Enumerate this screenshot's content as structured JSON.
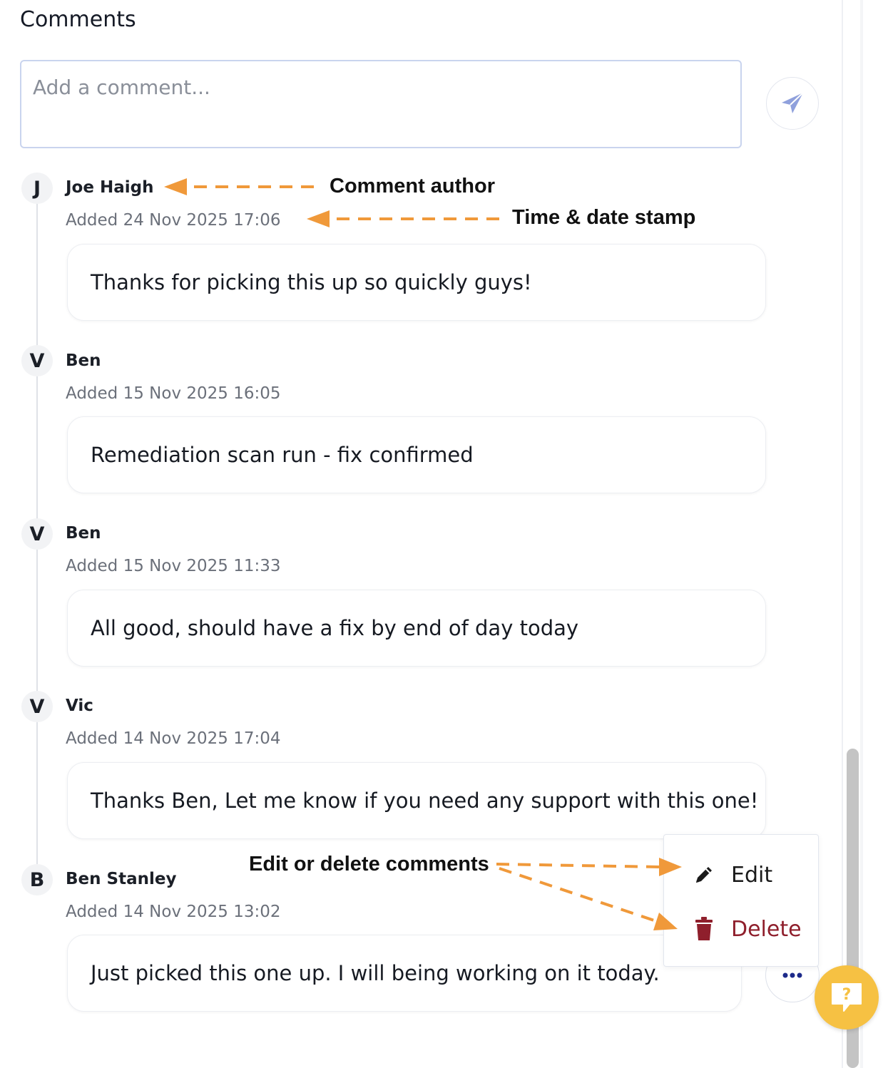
{
  "section": {
    "title": "Comments"
  },
  "composer": {
    "placeholder": "Add a comment...",
    "send_icon": "paper-plane-icon"
  },
  "comments": [
    {
      "initial": "J",
      "author": "Joe Haigh",
      "stamp": "Added 24 Nov 2025 17:06",
      "text": "Thanks for picking this up so quickly guys!"
    },
    {
      "initial": "V",
      "author": "Ben",
      "stamp": "Added 15 Nov 2025 16:05",
      "text": "Remediation scan run - fix confirmed"
    },
    {
      "initial": "V",
      "author": "Ben",
      "stamp": "Added 15 Nov 2025 11:33",
      "text": "All good, should have a fix by end of day today"
    },
    {
      "initial": "V",
      "author": "Vic",
      "stamp": "Added 14 Nov 2025 17:04",
      "text": "Thanks Ben, Let me know if you need any support with this one!"
    },
    {
      "initial": "B",
      "author": "Ben Stanley",
      "stamp": "Added 14 Nov 2025 13:02",
      "text": "Just picked this one up. I will being working on it today."
    }
  ],
  "annotations": {
    "author": "Comment author",
    "stamp": "Time & date stamp",
    "edit_delete": "Edit or delete comments"
  },
  "menu": {
    "edit_label": "Edit",
    "delete_label": "Delete",
    "edit_icon": "pencil-icon",
    "delete_icon": "trash-icon"
  },
  "colors": {
    "annotation_arrow": "#f0993a",
    "delete_red": "#8f1f2c",
    "send_icon": "#8fa0dc",
    "more_dots": "#1d2a8a",
    "help_yellow": "#f6c143"
  }
}
